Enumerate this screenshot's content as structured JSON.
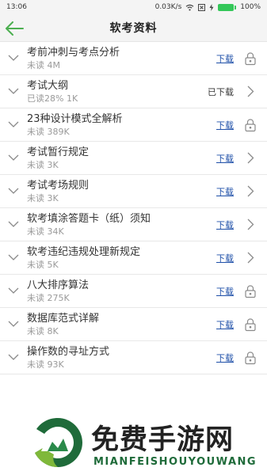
{
  "status": {
    "time": "13:06",
    "speed": "0.03K/s",
    "battery": "100%"
  },
  "header": {
    "title": "软考资料"
  },
  "colors": {
    "accent": "#4caf50",
    "link": "#1e4fa8"
  },
  "items": [
    {
      "name": "考前冲刺与考点分析",
      "meta": "未读  4M",
      "action": "下载",
      "trail": "lock-icon"
    },
    {
      "name": "考试大纲",
      "meta": "已读28%  1K",
      "action": "已下载",
      "trail": "chevron-right-icon"
    },
    {
      "name": "23种设计模式全解析",
      "meta": "未读  389K",
      "action": "下载",
      "trail": "lock-icon"
    },
    {
      "name": "考试暂行规定",
      "meta": "未读  3K",
      "action": "下载",
      "trail": "chevron-right-icon"
    },
    {
      "name": "考试考场规则",
      "meta": "未读  3K",
      "action": "下载",
      "trail": "chevron-right-icon"
    },
    {
      "name": "软考填涂答题卡（纸）须知",
      "meta": "未读  34K",
      "action": "下载",
      "trail": "chevron-right-icon"
    },
    {
      "name": "软考违纪违规处理新规定",
      "meta": "未读  5K",
      "action": "下载",
      "trail": "chevron-right-icon"
    },
    {
      "name": "八大排序算法",
      "meta": "未读  275K",
      "action": "下载",
      "trail": "lock-icon"
    },
    {
      "name": "数据库范式详解",
      "meta": "未读  8K",
      "action": "下载",
      "trail": "lock-icon"
    },
    {
      "name": "操作数的寻址方式",
      "meta": "未读  93K",
      "action": "下载",
      "trail": "lock-icon"
    }
  ],
  "watermark": {
    "cn": "免费手游网",
    "en": "MIANFEISHOUYOUWANG"
  }
}
